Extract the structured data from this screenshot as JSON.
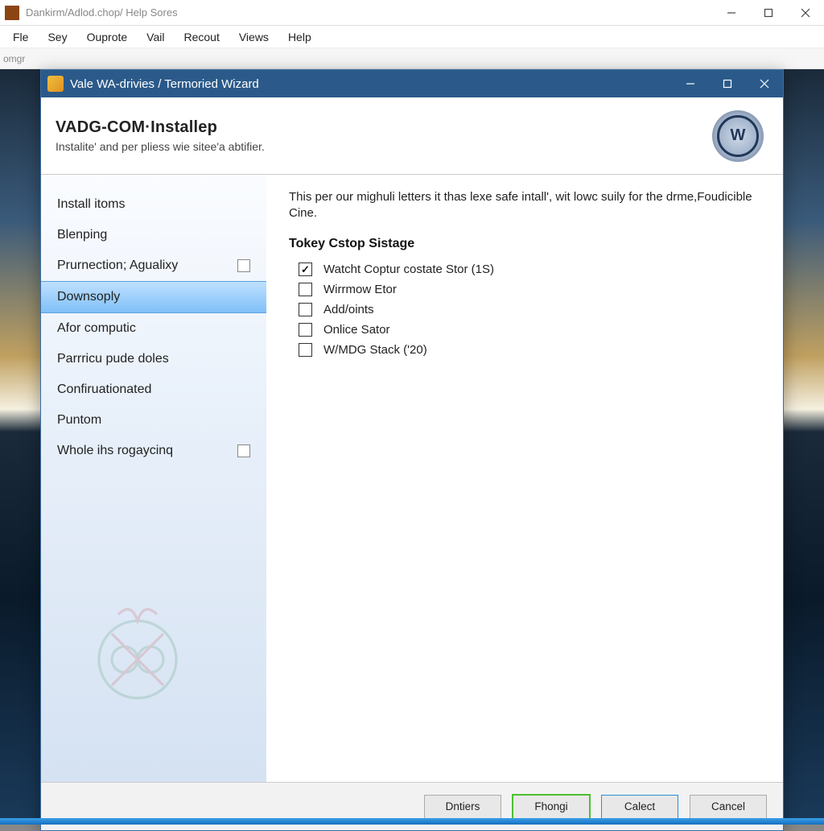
{
  "outer": {
    "title": "Dankirm/Adlod.chop/ Help Sores",
    "menu": [
      "Fle",
      "Sey",
      "Ouprote",
      "Vail",
      "Recout",
      "Views",
      "Help"
    ],
    "toolbar_left": "omgr"
  },
  "wizard": {
    "title": "Vale WA-drivies / Termoried Wizard",
    "header_title": "VADG-COM·Installep",
    "header_sub": "Instalite' and per pliess wie sitee'a abtifier.",
    "logo_text": "W"
  },
  "sidebar": {
    "items": [
      {
        "label": "Install itoms",
        "selected": false,
        "has_box": false
      },
      {
        "label": "Blenping",
        "selected": false,
        "has_box": false
      },
      {
        "label": "Prurnection; Agualixy",
        "selected": false,
        "has_box": true
      },
      {
        "label": "Downsoply",
        "selected": true,
        "has_box": false
      },
      {
        "label": "Afor computic",
        "selected": false,
        "has_box": false
      },
      {
        "label": "Parrricu pude doles",
        "selected": false,
        "has_box": false
      },
      {
        "label": "Confiruationated",
        "selected": false,
        "has_box": false
      },
      {
        "label": "Puntom",
        "selected": false,
        "has_box": false
      },
      {
        "label": "Whole ihs rogaycinq",
        "selected": false,
        "has_box": true
      }
    ]
  },
  "main": {
    "description": "This per our mighuli letters it thas lexe safe intall', wit lowc suily for the drme,Foudicible Cine.",
    "section_title": "Tokey Cstop Sistage",
    "options": [
      {
        "label": "Watcht Coptur costate Stor (1S)",
        "checked": true
      },
      {
        "label": "Wirrmow Etor",
        "checked": false
      },
      {
        "label": "Add/oints",
        "checked": false
      },
      {
        "label": "Onlice Sator",
        "checked": false
      },
      {
        "label": "W/MDG Stack ('20)",
        "checked": false
      }
    ]
  },
  "footer": {
    "buttons": [
      {
        "label": "Dntiers",
        "style": "plain"
      },
      {
        "label": "Fhongi",
        "style": "green"
      },
      {
        "label": "Calect",
        "style": "blue"
      },
      {
        "label": "Cancel",
        "style": "plain"
      }
    ]
  }
}
